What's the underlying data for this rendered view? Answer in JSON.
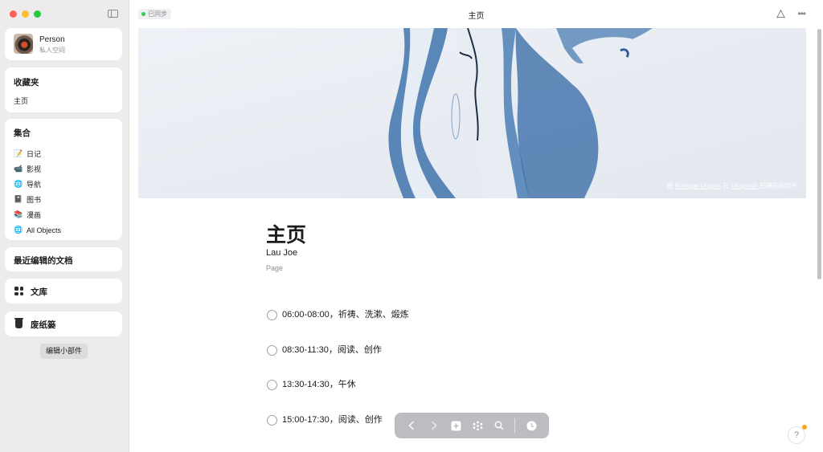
{
  "window": {
    "traffic_colors": [
      "#ff5f57",
      "#febc2e",
      "#28c840"
    ]
  },
  "sidebar": {
    "profile": {
      "name": "Person",
      "subtitle": "私人空间"
    },
    "favorites": {
      "title": "收藏夹",
      "items": [
        "主页"
      ]
    },
    "collections": {
      "title": "集合",
      "items": [
        {
          "icon": "📝",
          "icon_name": "notebook-icon",
          "label": "日记"
        },
        {
          "icon": "📹",
          "icon_name": "video-camera-icon",
          "label": "影视"
        },
        {
          "icon": "🌐",
          "icon_name": "globe-icon",
          "label": "导航"
        },
        {
          "icon": "📓",
          "icon_name": "book-icon",
          "label": "图书"
        },
        {
          "icon": "📚",
          "icon_name": "books-icon",
          "label": "漫画"
        },
        {
          "icon": "🌐",
          "icon_name": "globe-icon",
          "label": "All Objects"
        }
      ]
    },
    "recent": {
      "title": "最近编辑的文档"
    },
    "library": {
      "title": "文库"
    },
    "trash": {
      "title": "废纸篓"
    },
    "edit_widgets": "编辑小部件"
  },
  "topbar": {
    "sync_status": "已同步",
    "sync_color": "#34c759",
    "title": "主页"
  },
  "cover": {
    "credit_prefix": "由",
    "credit_author": "Kristaps Ungurs",
    "credit_mid": "在",
    "credit_site": "Unsplash",
    "credit_suffix": "拍摄的的照片"
  },
  "page": {
    "title": "主页",
    "author": "Lau Joe",
    "type": "Page"
  },
  "todos": [
    "06:00-08:00，祈祷、洗漱、煅炼",
    "08:30-11:30，阅读、创作",
    "13:30-14:30，午休",
    "15:00-17:30，阅读、创作"
  ],
  "help": {
    "label": "?"
  }
}
